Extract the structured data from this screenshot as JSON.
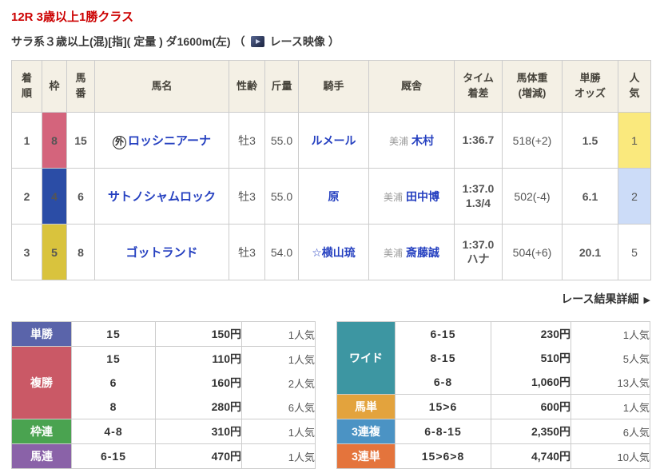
{
  "page": {
    "title": "12R 3歳以上1勝クラス",
    "conditions": "サラ系３歳以上(混)[指]( 定量 ) ダ1600m(左)",
    "paren_open": "（",
    "video_label": "レース映像",
    "paren_close": "）",
    "detail_link": "レース結果詳細",
    "detail_arrow": "▶"
  },
  "colors": {
    "title_red": "#cc0000",
    "link_blue": "#2540c0",
    "header_bg": "#f4f0e5",
    "border": "#cccccc"
  },
  "results_table": {
    "headers": [
      "着\n順",
      "枠",
      "馬\n番",
      "馬名",
      "性齢",
      "斤量",
      "騎手",
      "厩舎",
      "タイム\n着差",
      "馬体重\n(増減)",
      "単勝\nオッズ",
      "人\n気"
    ],
    "rows": [
      {
        "pos": "1",
        "bracket": "8",
        "bracket_color": "#d4647c",
        "num": "15",
        "mark": "外",
        "name": "ロッシニアーナ",
        "sex_age": "牡3",
        "weight": "55.0",
        "jockey": "ルメール",
        "stable_area": "美浦",
        "trainer": "木村",
        "time": "1:36.7",
        "margin": "",
        "body_weight": "518(+2)",
        "odds": "1.5",
        "popularity": "1",
        "popularity_bg": "#fae97d"
      },
      {
        "pos": "2",
        "bracket": "4",
        "bracket_color": "#2b4da6",
        "num": "6",
        "mark": "",
        "name": "サトノシャムロック",
        "sex_age": "牡3",
        "weight": "55.0",
        "jockey": "原",
        "stable_area": "美浦",
        "trainer": "田中博",
        "time": "1:37.0",
        "margin": "1.3/4",
        "body_weight": "502(-4)",
        "odds": "6.1",
        "popularity": "2",
        "popularity_bg": "#ccdcf8"
      },
      {
        "pos": "3",
        "bracket": "5",
        "bracket_color": "#d9c33d",
        "num": "8",
        "mark": "",
        "name": "ゴットランド",
        "sex_age": "牡3",
        "weight": "54.0",
        "jockey": "☆横山琉",
        "stable_area": "美浦",
        "trainer": "斎藤誠",
        "time": "1:37.0",
        "margin": "ハナ",
        "body_weight": "504(+6)",
        "odds": "20.1",
        "popularity": "5",
        "popularity_bg": ""
      }
    ]
  },
  "payouts_left": {
    "groups": [
      {
        "label": "単勝",
        "color": "#5a64aa",
        "rows": [
          {
            "sel": "15",
            "pay": "150円",
            "pop": "1人気"
          }
        ]
      },
      {
        "label": "複勝",
        "color": "#ca5966",
        "rows": [
          {
            "sel": "15",
            "pay": "110円",
            "pop": "1人気"
          },
          {
            "sel": "6",
            "pay": "160円",
            "pop": "2人気"
          },
          {
            "sel": "8",
            "pay": "280円",
            "pop": "6人気"
          }
        ]
      },
      {
        "label": "枠連",
        "color": "#4aa350",
        "rows": [
          {
            "sel": "4-8",
            "pay": "310円",
            "pop": "1人気"
          }
        ]
      },
      {
        "label": "馬連",
        "color": "#8a62a8",
        "rows": [
          {
            "sel": "6-15",
            "pay": "470円",
            "pop": "1人気"
          }
        ]
      }
    ]
  },
  "payouts_right": {
    "groups": [
      {
        "label": "ワイド",
        "color": "#3d96a2",
        "rows": [
          {
            "sel": "6-15",
            "pay": "230円",
            "pop": "1人気"
          },
          {
            "sel": "8-15",
            "pay": "510円",
            "pop": "5人気"
          },
          {
            "sel": "6-8",
            "pay": "1,060円",
            "pop": "13人気"
          }
        ]
      },
      {
        "label": "馬単",
        "color": "#e3a33d",
        "rows": [
          {
            "sel": "15>6",
            "pay": "600円",
            "pop": "1人気"
          }
        ]
      },
      {
        "label": "3連複",
        "color": "#4b93c4",
        "rows": [
          {
            "sel": "6-8-15",
            "pay": "2,350円",
            "pop": "6人気"
          }
        ]
      },
      {
        "label": "3連単",
        "color": "#e4743c",
        "rows": [
          {
            "sel": "15>6>8",
            "pay": "4,740円",
            "pop": "10人気"
          }
        ]
      }
    ]
  }
}
